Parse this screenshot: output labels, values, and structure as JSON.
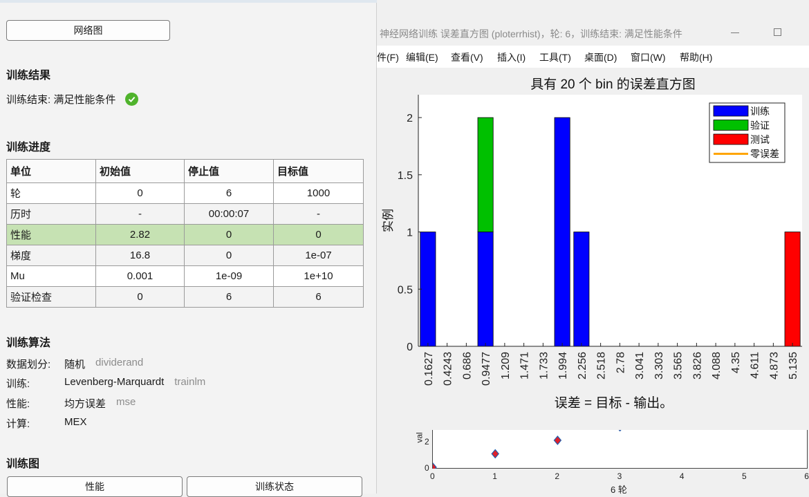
{
  "left_panel": {
    "network_button": "网络图",
    "results_title": "训练结果",
    "result_text": "训练结束: 满足性能条件",
    "progress_title": "训练进度",
    "progress_table": {
      "headers": [
        "单位",
        "初始值",
        "停止值",
        "目标值"
      ],
      "rows": [
        [
          "轮",
          "0",
          "6",
          "1000"
        ],
        [
          "历时",
          "-",
          "00:00:07",
          "-"
        ],
        [
          "性能",
          "2.82",
          "0",
          "0"
        ],
        [
          "梯度",
          "16.8",
          "0",
          "1e-07"
        ],
        [
          "Mu",
          "0.001",
          "1e-09",
          "1e+10"
        ],
        [
          "验证检查",
          "0",
          "6",
          "6"
        ]
      ]
    },
    "algorithms_title": "训练算法",
    "algorithms": [
      {
        "key": "数据划分:",
        "value": "随机",
        "fn": "dividerand"
      },
      {
        "key": "训练:",
        "value": "Levenberg-Marquardt",
        "fn": "trainlm"
      },
      {
        "key": "性能:",
        "value": "均方误差",
        "fn": "mse"
      },
      {
        "key": "计算:",
        "value": "MEX",
        "fn": ""
      }
    ],
    "plots_title": "训练图",
    "plot_buttons": [
      "性能",
      "训练状态"
    ]
  },
  "window": {
    "title": "神经网络训练 误差直方图 (ploterrhist)，轮: 6，训练结束: 满足性能条件",
    "menu": [
      "件(F)",
      "编辑(E)",
      "查看(V)",
      "插入(I)",
      "工具(T)",
      "桌面(D)",
      "窗口(W)",
      "帮助(H)"
    ]
  },
  "background_figure": {
    "ylabel": "val",
    "xlabel": "6 轮",
    "x_ticks": [
      "0",
      "1",
      "2",
      "3",
      "4",
      "5",
      "6"
    ],
    "y_ticks": [
      "0",
      "2"
    ]
  },
  "colors": {
    "train": "#0000ff",
    "validation": "#00c000",
    "test": "#ff0000",
    "zero_error": "#ffa500",
    "highlight_row": "#c6e2b3",
    "check": "#4fb32c"
  },
  "chart_data": {
    "type": "bar",
    "stacked": true,
    "title": "具有 20 个 bin 的误差直方图",
    "xlabel": "误差 = 目标 - 输出。",
    "ylabel": "实例",
    "ylim": [
      0,
      2.2
    ],
    "y_ticks": [
      "0",
      "0.5",
      "1",
      "1.5",
      "2"
    ],
    "legend_position": "top-right",
    "categories": [
      "0.1627",
      "0.4243",
      "0.686",
      "0.9477",
      "1.209",
      "1.471",
      "1.733",
      "1.994",
      "2.256",
      "2.518",
      "2.78",
      "3.041",
      "3.303",
      "3.565",
      "3.826",
      "4.088",
      "4.35",
      "4.611",
      "4.873",
      "5.135"
    ],
    "series": [
      {
        "name": "训练",
        "color": "#0000ff",
        "values": [
          1,
          0,
          0,
          1,
          0,
          0,
          0,
          2,
          1,
          0,
          0,
          0,
          0,
          0,
          0,
          0,
          0,
          0,
          0,
          0
        ]
      },
      {
        "name": "验证",
        "color": "#00c000",
        "values": [
          0,
          0,
          0,
          1,
          0,
          0,
          0,
          0,
          0,
          0,
          0,
          0,
          0,
          0,
          0,
          0,
          0,
          0,
          0,
          0
        ]
      },
      {
        "name": "测试",
        "color": "#ff0000",
        "values": [
          0,
          0,
          0,
          0,
          0,
          0,
          0,
          0,
          0,
          0,
          0,
          0,
          0,
          0,
          0,
          0,
          0,
          0,
          0,
          1
        ]
      },
      {
        "name": "零误差",
        "color": "#ffa500",
        "type": "line",
        "values": []
      }
    ]
  }
}
